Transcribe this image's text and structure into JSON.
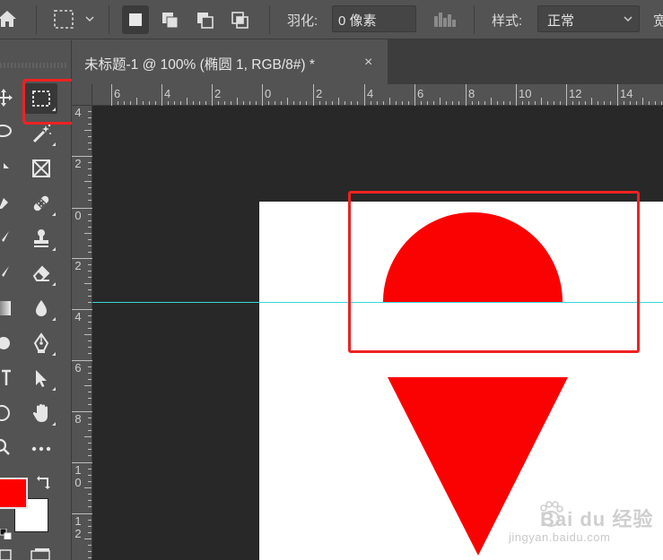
{
  "options_bar": {
    "feather_label": "羽化:",
    "feather_value": "0 像素",
    "style_label": "样式:",
    "style_value": "正常",
    "clipped_text": "宽"
  },
  "document_tab": {
    "title": "未标题-1 @ 100% (椭圆 1, RGB/8#) *",
    "close": "×"
  },
  "ruler_top": {
    "labels": [
      "6",
      "4",
      "2",
      "0",
      "2",
      "4",
      "6",
      "8",
      "10",
      "12",
      "14"
    ]
  },
  "ruler_left": {
    "labels": [
      "4",
      "2",
      "0",
      "2",
      "4",
      "6",
      "8",
      "1\n0",
      "1\n2"
    ]
  },
  "colors": {
    "foreground": "#ff0000",
    "background": "#ffffff",
    "shape_fill": "#fa0202",
    "guide": "#37d6d6",
    "highlight": "#ee2222"
  },
  "canvas": {
    "shapes": [
      "semicircle",
      "inverted-triangle"
    ]
  },
  "watermark": {
    "brand": "Bai du 经验",
    "url": "jingyan.baidu.com"
  }
}
